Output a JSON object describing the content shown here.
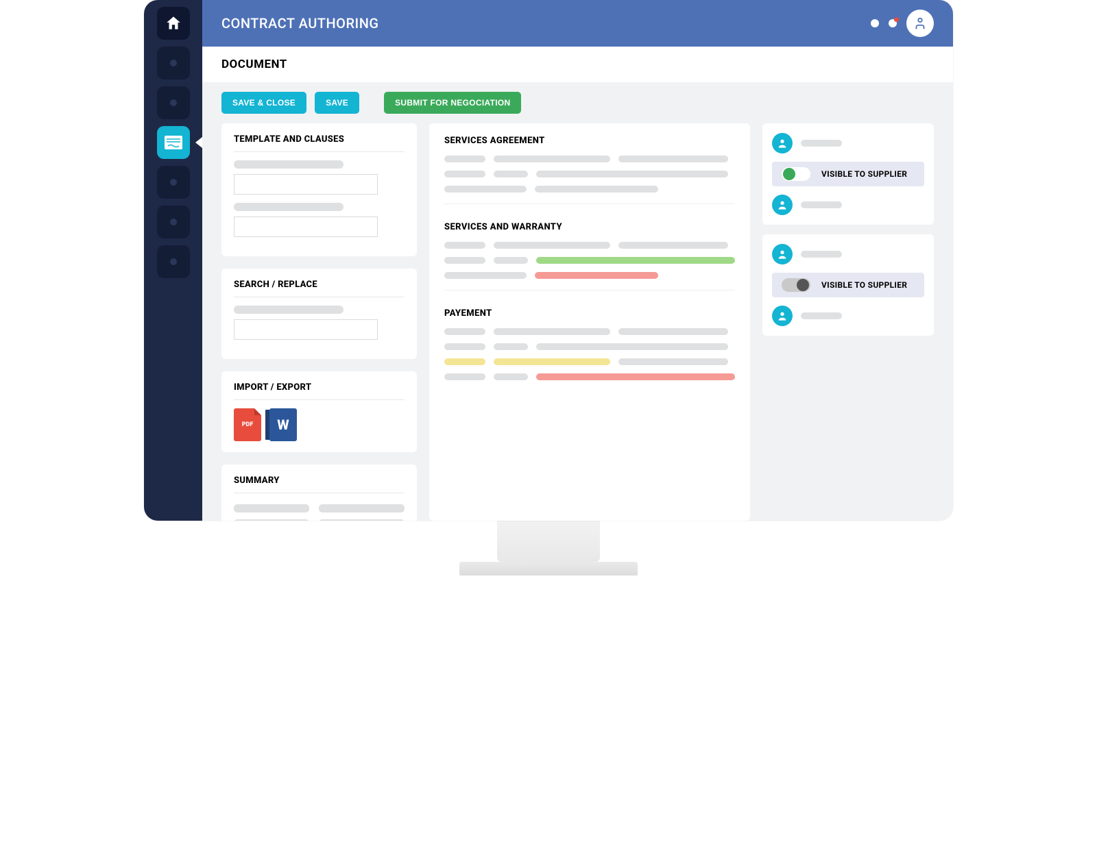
{
  "header": {
    "title": "CONTRACT AUTHORING"
  },
  "subheader": "DOCUMENT",
  "toolbar": {
    "save_close": "SAVE & CLOSE",
    "save": "SAVE",
    "submit": "SUBMIT FOR NEGOCIATION"
  },
  "left": {
    "templates_title": "TEMPLATE AND CLAUSES",
    "search_title": "SEARCH / REPLACE",
    "import_title": "IMPORT / EXPORT",
    "pdf_label": "PDF",
    "word_label": "W",
    "summary_title": "SUMMARY"
  },
  "doc": {
    "s1": "SERVICES AGREEMENT",
    "s2": "SERVICES AND WARRANTY",
    "s3": "PAYEMENT"
  },
  "right": {
    "visible_label": "VISIBLE TO SUPPLIER"
  },
  "colors": {
    "nav_bg": "#1e2948",
    "accent_cyan": "#14b4d3",
    "accent_green": "#3aaa5a",
    "topbar": "#4e71b6",
    "highlight_green": "#9fd987",
    "highlight_red": "#f59a95",
    "highlight_yellow": "#f4e594"
  }
}
